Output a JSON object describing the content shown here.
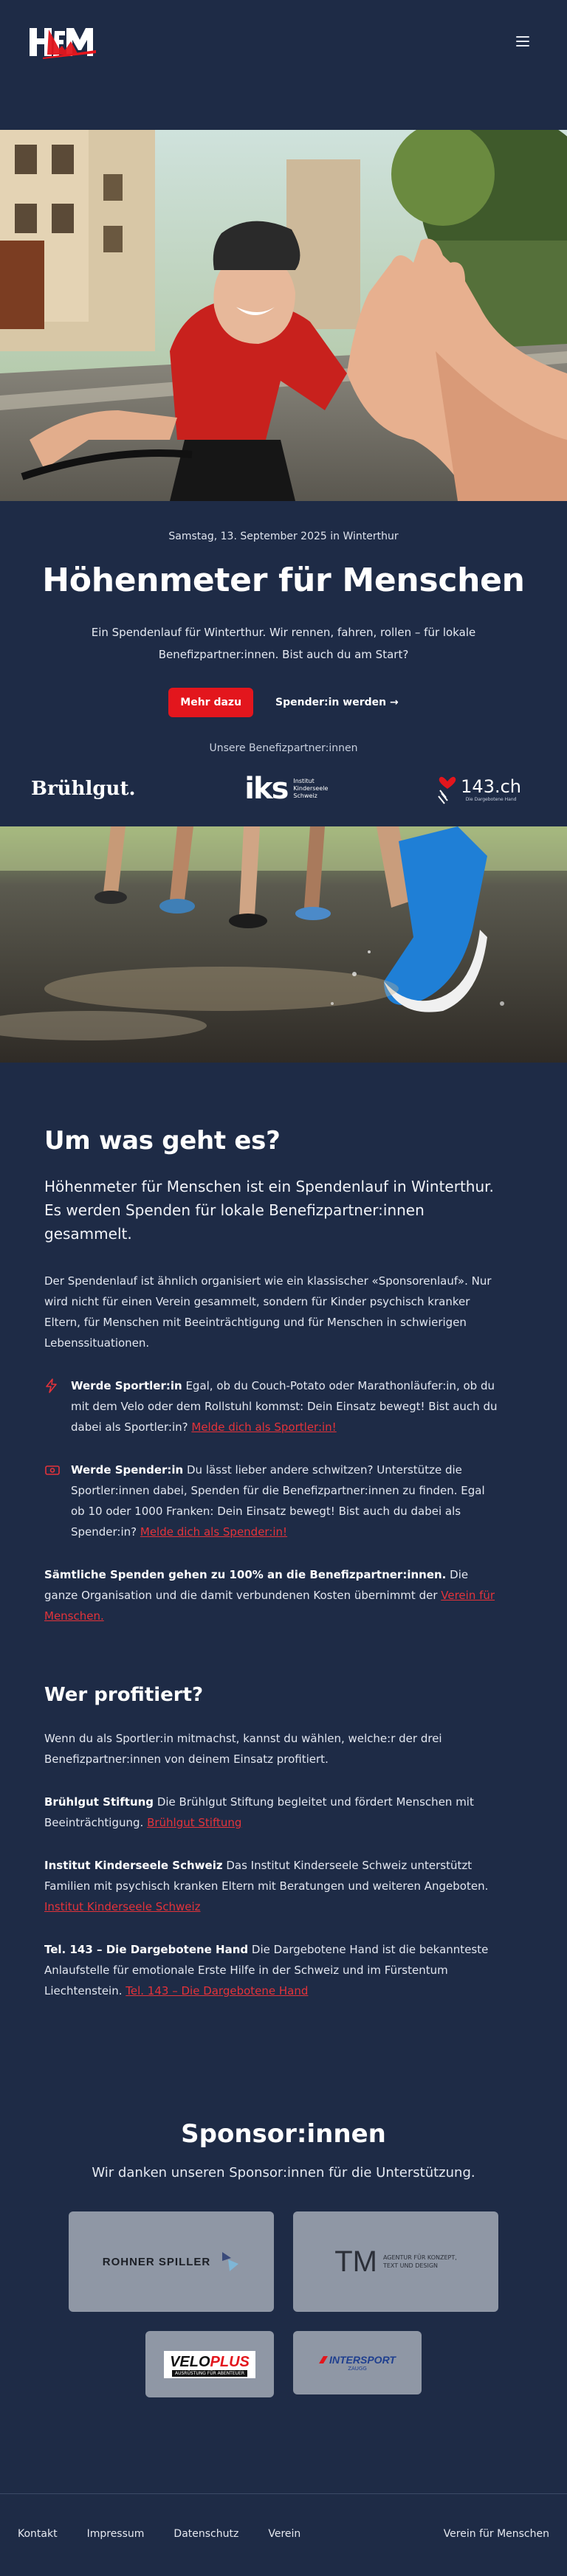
{
  "header": {
    "logo_text": "HfM",
    "menu_icon": "hamburger-icon"
  },
  "hero": {
    "date": "Samstag, 13. September 2025 in Winterthur",
    "title": "Höhenmeter für Menschen",
    "intro": "Ein Spendenlauf für Winterthur. Wir rennen, fahren, rollen – für lokale Benefizpartner:innen. Bist auch du am Start?",
    "cta_primary": "Mehr dazu",
    "cta_secondary": "Spender:in werden →",
    "partners_label": "Unsere Benefizpartner:innen",
    "partners": [
      {
        "name": "Brühlgut."
      },
      {
        "name": "Institut Kinderseele Schweiz",
        "mark": "iks",
        "lines": [
          "Institut",
          "Kinderseele",
          "Schweiz"
        ]
      },
      {
        "name": "143.ch",
        "tagline": "Die Dargebotene Hand"
      }
    ]
  },
  "about": {
    "heading": "Um was geht es?",
    "lead": "Höhenmeter für Menschen ist ein Spendenlauf in Winterthur. Es werden Spenden für lokale Benefizpartner:innen gesammelt.",
    "paragraph": "Der Spendenlauf ist ähnlich organisiert wie ein klassischer «Sponsorenlauf». Nur wird nicht für einen Verein gesammelt, sondern für Kinder psychisch kranker Eltern, für Menschen mit Beeinträchtigung und für Menschen in schwierigen Lebenssituationen.",
    "features": [
      {
        "icon": "lightning-icon",
        "title": "Werde Sportler:in",
        "text": " Egal, ob du Couch-Potato oder Marathonläufer:in, ob du mit dem Velo oder dem Rollstuhl kommst: Dein Einsatz bewegt! Bist auch du dabei als Sportler:in? ",
        "link": "Melde dich als Sportler:in!"
      },
      {
        "icon": "money-icon",
        "title": "Werde Spender:in",
        "text": " Du lässt lieber andere schwitzen? Unterstütze die Sportler:innen dabei, Spenden für die Benefizpartner:innen zu finden. Egal ob 10 oder 1000 Franken: Dein Einsatz bewegt! Bist auch du dabei als Spender:in? ",
        "link": "Melde dich als Spender:in!"
      }
    ],
    "donation_note_bold": "Sämtliche Spenden gehen zu 100% an die Benefizpartner:innen.",
    "donation_note_text": " Die ganze Organisation und die damit verbundenen Kosten übernimmt der ",
    "donation_note_link": "Verein für Menschen."
  },
  "beneficiaries": {
    "heading": "Wer profitiert?",
    "intro": "Wenn du als Sportler:in mitmachst, kannst du wählen, welche:r der drei Benefizpartner:innen von deinem Einsatz profitiert.",
    "items": [
      {
        "name": "Brühlgut Stiftung",
        "text": " Die Brühlgut Stiftung begleitet und fördert Menschen mit Beeinträchtigung. ",
        "link": "Brühlgut Stiftung"
      },
      {
        "name": "Institut Kinderseele Schweiz",
        "text": " Das Institut Kinderseele Schweiz unterstützt Familien mit psychisch kranken Eltern mit Beratungen und weiteren Angeboten. ",
        "link": "Institut Kinderseele Schweiz"
      },
      {
        "name": "Tel. 143 – Die Dargebotene Hand",
        "text": " Die Dargebotene Hand ist die bekannteste Anlaufstelle für emotionale Erste Hilfe in der Schweiz und im Fürstentum Liechtenstein. ",
        "link": "Tel. 143 – Die Dargebotene Hand"
      }
    ]
  },
  "sponsors": {
    "heading": "Sponsor:innen",
    "lead": "Wir danken unseren Sponsor:innen für die Unterstützung.",
    "items": [
      {
        "name": "ROHNER SPILLER"
      },
      {
        "name": "TM",
        "tagline": [
          "AGENTUR FÜR KONZEPT,",
          "TEXT UND DESIGN"
        ]
      },
      {
        "name": "VELOPLUS",
        "prefix": "VELO",
        "suffix": "PLUS",
        "tagline": "AUSRÜSTUNG FÜR ABENTEUER"
      },
      {
        "name": "INTERSPORT",
        "tagline": "ZAUGG"
      }
    ]
  },
  "footer": {
    "links": [
      "Kontakt",
      "Impressum",
      "Datenschutz",
      "Verein"
    ],
    "org": "Verein für Menschen"
  },
  "colors": {
    "background": "#1e2b46",
    "accent_red": "#e3161d",
    "link_red": "#e4333a",
    "sponsor_card": "#8f97a5"
  }
}
